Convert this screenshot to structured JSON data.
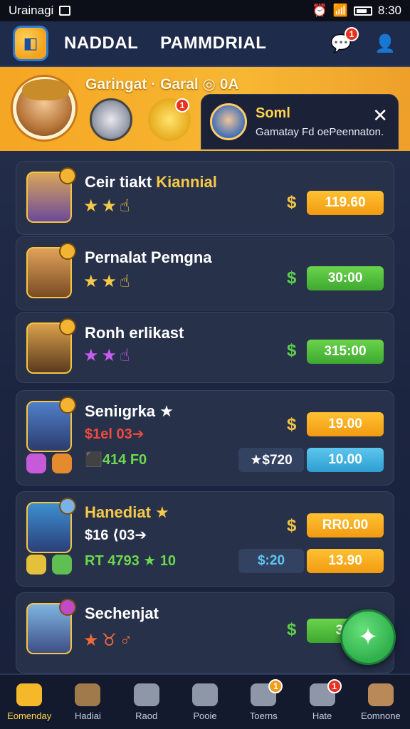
{
  "status": {
    "left_text": "Urainagi",
    "time": "8:30"
  },
  "appbar": {
    "title_left": "NADDAL",
    "title_right": "PAMMDRIAL",
    "notif_badge": "1"
  },
  "banner": {
    "title": "Garingat · Garal  ◎ 0A",
    "bag_badge": "1"
  },
  "notification": {
    "title": "Soml",
    "subtitle": "Gamatay Fd oePeennaton."
  },
  "cards": [
    {
      "name": "Ceir tiakt",
      "name_accent": "Kiannial",
      "stars": "★★☝",
      "prices": [
        "119.60"
      ],
      "price_colors": [
        "orange"
      ]
    },
    {
      "name": "Pernalat Pemgna",
      "stars": "★★☝",
      "prices": [
        "30:00"
      ],
      "price_colors": [
        "green"
      ]
    },
    {
      "name": "Ronh erlikast",
      "stars": "★★☝",
      "prices": [
        "315:00"
      ],
      "price_colors": [
        "green"
      ]
    },
    {
      "name": "Seniıgrka ★",
      "sub1": "$1el 03➔",
      "sub2": "⬛414 F0",
      "pill": "★$720",
      "prices": [
        "19.00",
        "10.00"
      ],
      "price_colors": [
        "orange",
        "blue"
      ]
    },
    {
      "name": "Hanediat ★",
      "sub1": "$16 ⟨03➔",
      "sub2": "RT 4793 ★ 10",
      "pill": "$:20",
      "prices": [
        "RR0.00",
        "13.90"
      ],
      "price_colors": [
        "orange",
        "orange"
      ]
    },
    {
      "name": "Sechenjat",
      "stars": "★♉♂",
      "prices": [
        "3.9"
      ],
      "price_colors": [
        "green"
      ]
    }
  ],
  "fab": {
    "icon": "✦"
  },
  "nav": [
    {
      "label": "Eomenday",
      "active": true
    },
    {
      "label": "Hadiai"
    },
    {
      "label": "Raod"
    },
    {
      "label": "Pooie"
    },
    {
      "label": "Toerns",
      "badge": "1"
    },
    {
      "label": "Hate",
      "badge": "1"
    },
    {
      "label": "Eomnone"
    }
  ]
}
